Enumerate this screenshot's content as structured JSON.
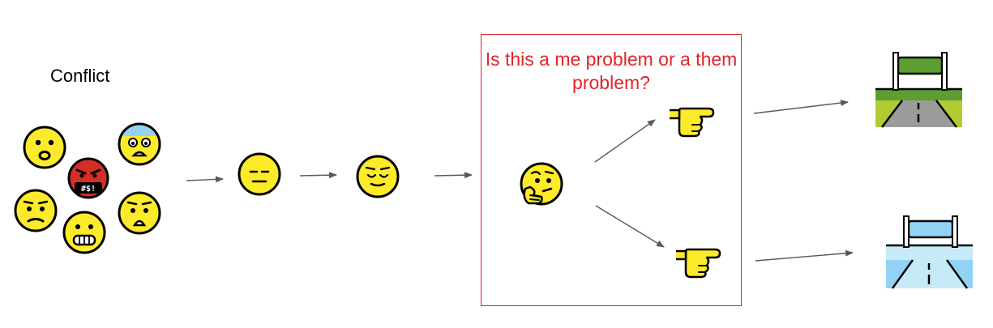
{
  "labels": {
    "conflict": "Conflict",
    "question": "Is this a me problem or a them problem?"
  },
  "emoji_groups": {
    "conflict_faces": [
      "frowning-face-icon",
      "anxious-face-icon",
      "cursing-face-icon",
      "confused-face-icon",
      "grimacing-face-icon",
      "hushed-face-icon"
    ],
    "calming_sequence": [
      "expressionless-face-icon",
      "relieved-face-icon"
    ],
    "decision": "thinking-face-icon",
    "pointers": [
      "pointing-right-hand-icon",
      "pointing-right-hand-icon"
    ],
    "outcomes": [
      "road-grass-icon",
      "road-water-icon"
    ]
  },
  "colors": {
    "face_yellow": "#fcea2b",
    "face_outline": "#000000",
    "angry_red": "#d22f27",
    "anxious_blue": "#92d3f5",
    "box_red": "#e0252b",
    "arrow_gray": "#595959",
    "grass_green": "#5c9e31",
    "grass_light": "#b1cc33",
    "water_light": "#c6eaf7",
    "water_blue": "#92d3f5",
    "road_gray": "#9b9b9a"
  }
}
